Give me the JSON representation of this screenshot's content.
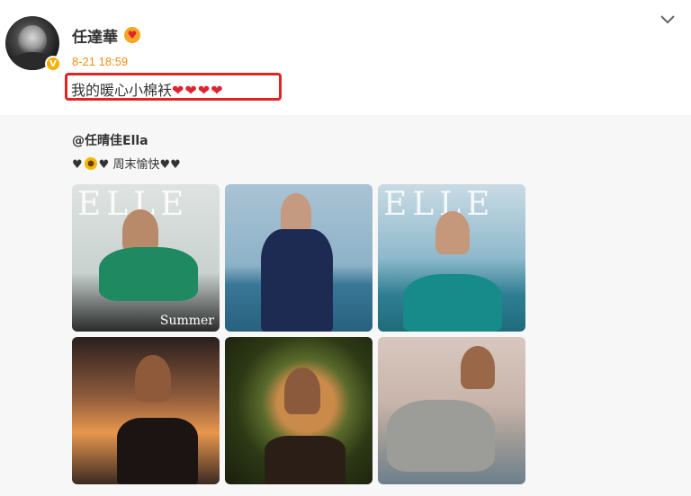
{
  "post": {
    "username": "任達華",
    "timestamp": "8-21 18:59",
    "text": "我的暖心小棉袄",
    "text_hearts": "❤❤❤❤"
  },
  "repost": {
    "mention": "@任晴佳Ella",
    "text_prefix": "♥",
    "text_mid": "♥ 周末愉快♥♥"
  },
  "photos": {
    "magazine_logo": "ELLE",
    "cover_text": "Summer"
  },
  "colors": {
    "timestamp": "#f28f12",
    "highlight_border": "#e52222",
    "verified_badge": "#f6b000"
  },
  "icons": [
    "avatar",
    "verified-badge-icon",
    "emoji-heart-icon",
    "chevron-down-icon",
    "sunflower-emoji-icon"
  ]
}
